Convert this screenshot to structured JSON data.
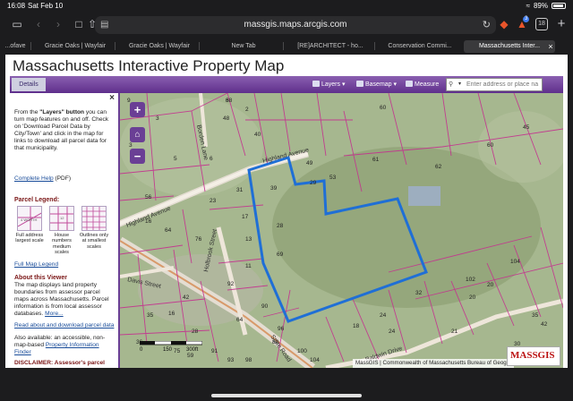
{
  "status": {
    "time": "16:08",
    "date": "Sat Feb 10",
    "battery": "89%"
  },
  "browser": {
    "url": "massgis.maps.arcgis.com",
    "tab_count": "18",
    "shield_badge": "3",
    "tabs": [
      {
        "label": "...ofave",
        "active": false
      },
      {
        "label": "Gracie Oaks | Wayfair",
        "active": false
      },
      {
        "label": "Gracie Oaks | Wayfair",
        "active": false
      },
      {
        "label": "New Tab",
        "active": false
      },
      {
        "label": "[RE]ARCHITECT - ho...",
        "active": false
      },
      {
        "label": "Conservation Commi...",
        "active": false
      },
      {
        "label": "Massachusetts Inter...",
        "active": true
      }
    ]
  },
  "page": {
    "title": "Massachusetts Interactive Property Map",
    "menubar": {
      "details": "Details",
      "layers": "Layers",
      "basemap": "Basemap",
      "measure": "Measure",
      "search_placeholder": "Enter address or place na"
    },
    "sidebar": {
      "intro_pre": "From the ",
      "intro_bold": "\"Layers\" button",
      "intro_post": " you can turn map features on and off. Check on 'Download Parcel Data by City/Town' and click in the map for links to download all parcel data for that municipality.",
      "help_link": "Complete Help",
      "help_suffix": " (PDF)",
      "legend_heading": "Parcel Legend:",
      "legend_items": [
        {
          "caption": "Full address largest scale"
        },
        {
          "caption": "House numbers medium scales"
        },
        {
          "caption": "Outlines only at smallest scales"
        }
      ],
      "legend_link": "Full Map Legend",
      "about_heading": "About this Viewer",
      "about_text": "The map displays land property boundaries from assessor parcel maps across Massachusetts. Parcel information is from local assessor databases. ",
      "about_more": "More...",
      "read_link": "Read about and download parcel data",
      "also_text": "Also available: an accessible, non-map-based ",
      "also_link": "Property Information Finder",
      "disclaimer": "DISCLAIMER: Assessor's parcel"
    },
    "map": {
      "streets": [
        "Highland Avenue",
        "Highland Avenue",
        "Holbrook Street",
        "Davis Street",
        "State Road",
        "Baldwin Drive",
        "Borden Lane"
      ],
      "parcels": [
        "3",
        "2",
        "60",
        "40",
        "49",
        "53",
        "61",
        "62",
        "60",
        "45",
        "23",
        "39",
        "17",
        "13",
        "11",
        "76",
        "31",
        "29",
        "28",
        "64",
        "56",
        "3",
        "9",
        "24",
        "32",
        "20",
        "92",
        "90",
        "80",
        "96",
        "100",
        "104",
        "18",
        "16",
        "28",
        "24",
        "21",
        "20",
        "35",
        "75",
        "59",
        "91",
        "93",
        "98",
        "102",
        "104",
        "42",
        "30",
        "35",
        "36",
        "42",
        "69",
        "48",
        "3",
        "5",
        "6",
        "16",
        "64",
        "68"
      ],
      "scale_labels": [
        "0",
        "150",
        "300ft"
      ],
      "attribution": "MassGIS | Commonwealth of Massachusetts Bureau of Geog...",
      "logo": "MASSGIS",
      "highlight_color": "#1f6fd6"
    }
  }
}
